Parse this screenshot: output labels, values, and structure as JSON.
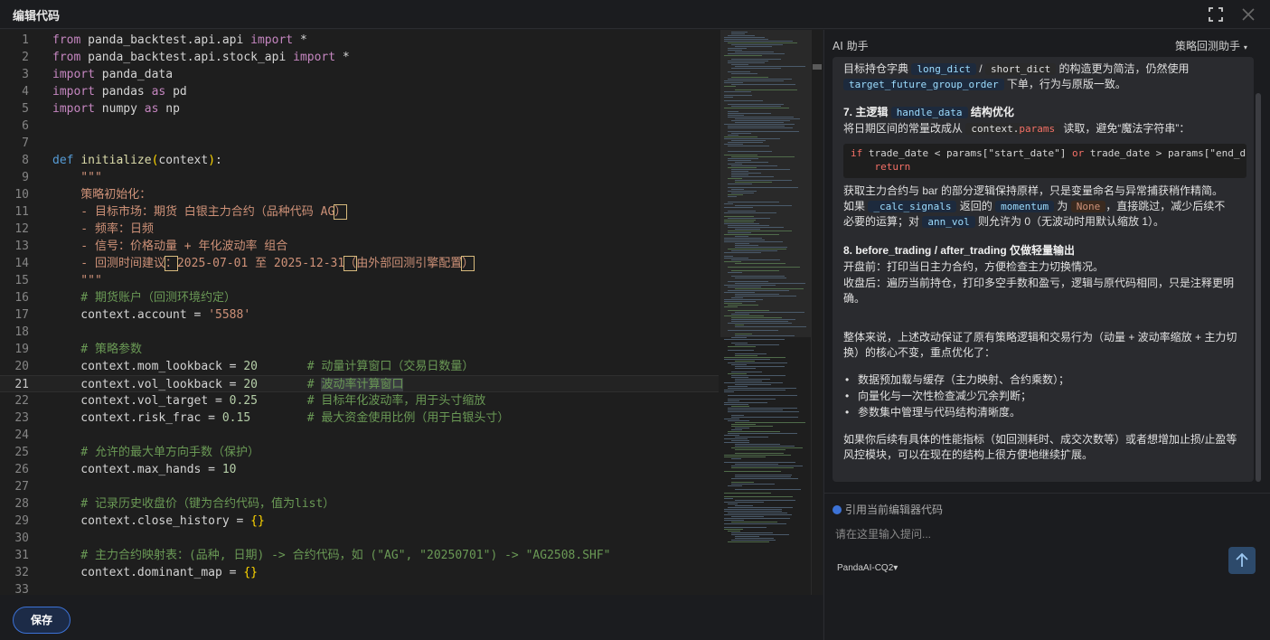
{
  "window": {
    "title": "编辑代码"
  },
  "editor": {
    "current_line": 21,
    "lines": [
      {
        "no": "1",
        "t": [
          [
            "kw",
            "from"
          ],
          [
            "d",
            " panda_backtest.api.api "
          ],
          [
            "kw",
            "import"
          ],
          [
            "d",
            " *"
          ]
        ]
      },
      {
        "no": "2",
        "t": [
          [
            "kw",
            "from"
          ],
          [
            "d",
            " panda_backtest.api.stock_api "
          ],
          [
            "kw",
            "import"
          ],
          [
            "d",
            " *"
          ]
        ]
      },
      {
        "no": "3",
        "t": [
          [
            "kw",
            "import"
          ],
          [
            "d",
            " panda_data"
          ]
        ]
      },
      {
        "no": "4",
        "t": [
          [
            "kw",
            "import"
          ],
          [
            "d",
            " pandas "
          ],
          [
            "kw",
            "as"
          ],
          [
            "d",
            " pd"
          ]
        ]
      },
      {
        "no": "5",
        "t": [
          [
            "kw",
            "import"
          ],
          [
            "d",
            " numpy "
          ],
          [
            "kw",
            "as"
          ],
          [
            "d",
            " np"
          ]
        ]
      },
      {
        "no": "6",
        "t": []
      },
      {
        "no": "7",
        "t": []
      },
      {
        "no": "8",
        "t": [
          [
            "k",
            "def"
          ],
          [
            "d",
            " "
          ],
          [
            "f",
            "initialize"
          ],
          [
            "y",
            "("
          ],
          [
            "d",
            "context"
          ],
          [
            "y",
            ")"
          ],
          [
            "d",
            ":"
          ]
        ]
      },
      {
        "no": "9",
        "t": [
          [
            "doc",
            "    \"\"\""
          ]
        ]
      },
      {
        "no": "10",
        "t": [
          [
            "doc",
            "    策略初始化："
          ]
        ]
      },
      {
        "no": "11",
        "t": [
          [
            "doc",
            "    - 目标市场：期货 白银主力合约（品种代码 AG"
          ],
          [
            "bx",
            "）"
          ]
        ]
      },
      {
        "no": "12",
        "t": [
          [
            "doc",
            "    - 频率：日频"
          ]
        ]
      },
      {
        "no": "13",
        "t": [
          [
            "doc",
            "    - 信号：价格动量 + 年化波动率 组合"
          ]
        ]
      },
      {
        "no": "14",
        "t": [
          [
            "doc",
            "    - 回测时间建议"
          ],
          [
            "bx",
            "："
          ],
          [
            "doc",
            "2025-07-01 至 2025-12-31"
          ],
          [
            "bx",
            "（"
          ],
          [
            "doc",
            "由外部回测引擎配置"
          ],
          [
            "bx",
            "）"
          ]
        ]
      },
      {
        "no": "15",
        "t": [
          [
            "doc",
            "    \"\"\""
          ]
        ]
      },
      {
        "no": "16",
        "t": [
          [
            "c",
            "    # 期货账户（回测环境约定）"
          ]
        ]
      },
      {
        "no": "17",
        "t": [
          [
            "d",
            "    context.account = "
          ],
          [
            "s",
            "'5588'"
          ]
        ]
      },
      {
        "no": "18",
        "t": []
      },
      {
        "no": "19",
        "t": [
          [
            "c",
            "    # 策略参数"
          ]
        ]
      },
      {
        "no": "20",
        "t": [
          [
            "d",
            "    context.mom_lookback = "
          ],
          [
            "n",
            "20"
          ],
          [
            "d",
            "       "
          ],
          [
            "c",
            "# 动量计算窗口（交易日数量）"
          ]
        ]
      },
      {
        "no": "21",
        "t": [
          [
            "d",
            "    context.vol_lookback = "
          ],
          [
            "n",
            "20"
          ],
          [
            "d",
            "       "
          ],
          [
            "c",
            "# "
          ],
          [
            "hl",
            "波动率计算窗口"
          ]
        ]
      },
      {
        "no": "22",
        "t": [
          [
            "d",
            "    context.vol_target = "
          ],
          [
            "n",
            "0.25"
          ],
          [
            "d",
            "       "
          ],
          [
            "c",
            "# 目标年化波动率，用于头寸缩放"
          ]
        ]
      },
      {
        "no": "23",
        "t": [
          [
            "d",
            "    context.risk_frac = "
          ],
          [
            "n",
            "0.15"
          ],
          [
            "d",
            "        "
          ],
          [
            "c",
            "# 最大资金使用比例（用于白银头寸）"
          ]
        ]
      },
      {
        "no": "24",
        "t": []
      },
      {
        "no": "25",
        "t": [
          [
            "c",
            "    # 允许的最大单方向手数（保护）"
          ]
        ]
      },
      {
        "no": "26",
        "t": [
          [
            "d",
            "    context.max_hands = "
          ],
          [
            "n",
            "10"
          ]
        ]
      },
      {
        "no": "27",
        "t": []
      },
      {
        "no": "28",
        "t": [
          [
            "c",
            "    # 记录历史收盘价（键为合约代码，值为list）"
          ]
        ]
      },
      {
        "no": "29",
        "t": [
          [
            "d",
            "    context.close_history = "
          ],
          [
            "y",
            "{}"
          ]
        ]
      },
      {
        "no": "30",
        "t": []
      },
      {
        "no": "31",
        "t": [
          [
            "c",
            "    # 主力合约映射表：(品种, 日期) -> 合约代码，如 (\"AG\", \"20250701\") -> \"AG2508.SHF\""
          ]
        ]
      },
      {
        "no": "32",
        "t": [
          [
            "d",
            "    context.dominant_map = "
          ],
          [
            "y",
            "{}"
          ]
        ]
      },
      {
        "no": "33",
        "t": []
      }
    ]
  },
  "footer": {
    "save_label": "保存"
  },
  "panel": {
    "title": "AI 助手",
    "agent": "策略回测助手",
    "chat": {
      "p1": "目标持仓字典",
      "p1_code1": "long_dict",
      "p1_mid": " / ",
      "p1_code2": "short_dict",
      "p1_end": " 的构造更为简洁，仍然使用",
      "p2_code": "target_future_group_order",
      "p2_end": " 下单，行为与原版一致。",
      "h7_pre": "7. 主逻辑 ",
      "h7_code": "handle_data",
      "h7_end": " 结构优化",
      "p3_pre": "将日期区间的常量改成从 ",
      "p3_code_a": "context.",
      "p3_code_b": "params",
      "p3_end": " 读取，避免“魔法字符串”：",
      "code1_if": "if",
      "code1_a": " trade_date < params[\"start_date\"] ",
      "code1_or": "or",
      "code1_b": " trade_date > params[\"end_d",
      "code2": "    return",
      "p4": "获取主力合约与 bar 的部分逻辑保持原样，只是变量命名与异常捕获稍作精简。",
      "p5_pre": "如果 ",
      "p5_code1": "_calc_signals",
      "p5_mid1": " 返回的 ",
      "p5_code2": "momentum",
      "p5_mid2": " 为 ",
      "p5_code3": "None",
      "p5_end": "，直接跳过，减少后续不",
      "p6_pre": "必要的运算；对 ",
      "p6_code": "ann_vol",
      "p6_end": " 则允许为 0（无波动时用默认缩放 1）。",
      "h8": "8. before_trading / after_trading 仅做轻量输出",
      "p7": "开盘前：打印当日主力合约，方便检查主力切换情况。",
      "p8a": "收盘后：遍历当前持仓，打印多空手数和盈亏，逻辑与原代码相同，只是注释更明",
      "p8b": "确。",
      "p9a": "整体来说，上述改动保证了原有策略逻辑和交易行为（动量 + 波动率缩放 + 主力切",
      "p9b": "换）的核心不变，重点优化了：",
      "bullets": [
        "数据预加载与缓存（主力映射、合约乘数）；",
        "向量化与一次性检查减少冗余判断；",
        "参数集中管理与代码结构清晰度。"
      ],
      "p10a": "如果你后续有具体的性能指标（如回测耗时、成交次数等）或者想增加止损/止盈等",
      "p10b": "风控模块，可以在现在的结构上很方便地继续扩展。"
    },
    "include_code_label": "引用当前编辑器代码",
    "input_placeholder": "请在这里输入提问...",
    "model": "PandaAI-CQ2"
  }
}
